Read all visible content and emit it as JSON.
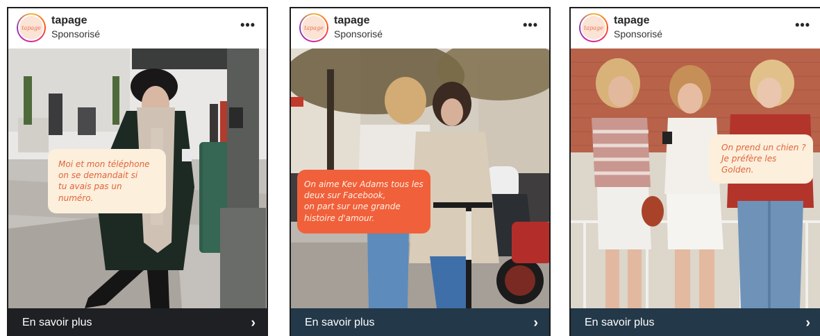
{
  "posts": [
    {
      "username": "tapage",
      "sponsored": "Sponsorisé",
      "avatar_text": "tapage",
      "menu_icon": "more-horizontal-icon",
      "caption": "Moi et mon téléphone\non se demandait si\ntu avais pas un numéro.",
      "caption_style": "cream",
      "cta": "En savoir plus",
      "cta_icon": "chevron-right-icon"
    },
    {
      "username": "tapage",
      "sponsored": "Sponsorisé",
      "avatar_text": "tapage",
      "menu_icon": "more-horizontal-icon",
      "caption": "On aime Kev Adams tous les\ndeux sur Facebook,\non part sur une grande\nhistoire d'amour.",
      "caption_style": "orange",
      "cta": "En savoir plus",
      "cta_icon": "chevron-right-icon"
    },
    {
      "username": "tapage",
      "sponsored": "Sponsorisé",
      "avatar_text": "tapage",
      "menu_icon": "more-horizontal-icon",
      "caption": "On prend un chien ?\nJe préfère les Golden.",
      "caption_style": "cream",
      "cta": "En savoir plus",
      "cta_icon": "chevron-right-icon"
    }
  ],
  "colors": {
    "cta_dark": "#1f2024",
    "cta_navy": "#233848",
    "bubble_cream": "#fcefdc",
    "bubble_orange": "#f0603b",
    "caption_orange": "#e2643a"
  }
}
